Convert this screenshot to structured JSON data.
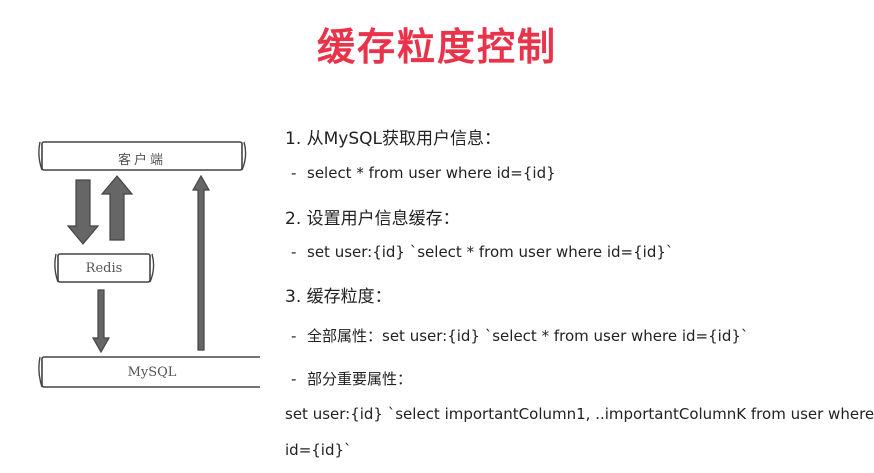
{
  "title": "缓存粒度控制",
  "colors": {
    "title": "#e8334a",
    "arrow_fill": "#666666",
    "arrow_stroke": "#444444",
    "box_stroke": "#444444"
  },
  "diagram": {
    "client_label": "客户端",
    "redis_label": "Redis",
    "mysql_label": "MySQL"
  },
  "content": {
    "heading1": "1. 从MySQL获取用户信息：",
    "item1_dash": "-",
    "item1_text": "select * from user where id={id}",
    "heading2": "2. 设置用户信息缓存：",
    "item2_dash": "-",
    "item2_text": "set user:{id} `select * from user where id={id}`",
    "heading3": "3. 缓存粒度：",
    "item3_dash": "-",
    "item3_text": "全部属性：set user:{id}  `select * from user where id={id}`",
    "item4_dash": "-",
    "item4_text": "部分重要属性：",
    "para_line1": "set user:{id} `select importantColumn1, ..importantColumnK from user where",
    "para_line2": "id={id}`"
  }
}
